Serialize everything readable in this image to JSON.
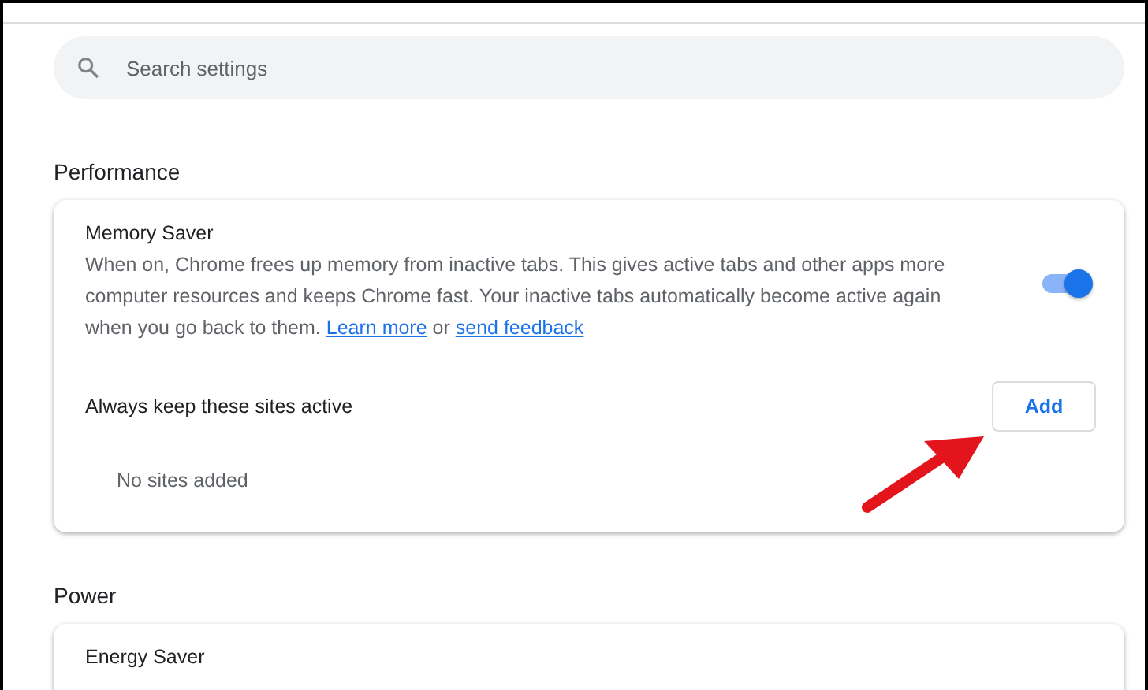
{
  "search": {
    "placeholder": "Search settings"
  },
  "sections": [
    {
      "heading": "Performance",
      "card": {
        "title": "Memory Saver",
        "description": [
          {
            "kind": "text",
            "text": "When on, Chrome frees up memory from inactive tabs. This gives active tabs and other apps more computer resources and keeps Chrome fast. Your inactive tabs automatically become active again when you go back to them. "
          },
          {
            "kind": "link",
            "text": "Learn more"
          },
          {
            "kind": "text",
            "text": " or "
          },
          {
            "kind": "link",
            "text": "send feedback"
          }
        ],
        "on": true,
        "sites_label": "Always keep these sites active",
        "add_button": "Add",
        "empty_text": "No sites added"
      }
    },
    {
      "heading": "Power",
      "card": {
        "title": "Energy Saver"
      }
    }
  ]
}
